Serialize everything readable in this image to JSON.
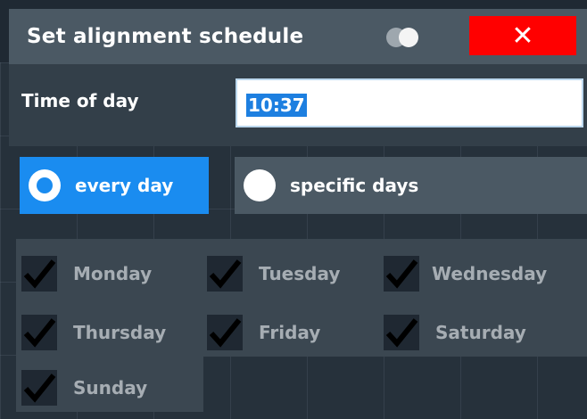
{
  "dialog": {
    "title": "Set alignment schedule",
    "close_label": "✕"
  },
  "time_of_day": {
    "label": "Time of day",
    "value": "10:37"
  },
  "repeat": {
    "options": [
      {
        "label": "every day",
        "selected": true
      },
      {
        "label": "specific days",
        "selected": false
      }
    ]
  },
  "days": [
    {
      "label": "Monday",
      "checked": true
    },
    {
      "label": "Tuesday",
      "checked": true
    },
    {
      "label": "Wednesday",
      "checked": true
    },
    {
      "label": "Thursday",
      "checked": true
    },
    {
      "label": "Friday",
      "checked": true
    },
    {
      "label": "Saturday",
      "checked": true
    },
    {
      "label": "Sunday",
      "checked": true
    }
  ],
  "colors": {
    "accent": "#1a8cf0",
    "close": "#ff0000",
    "title_bar": "#4b5964"
  }
}
